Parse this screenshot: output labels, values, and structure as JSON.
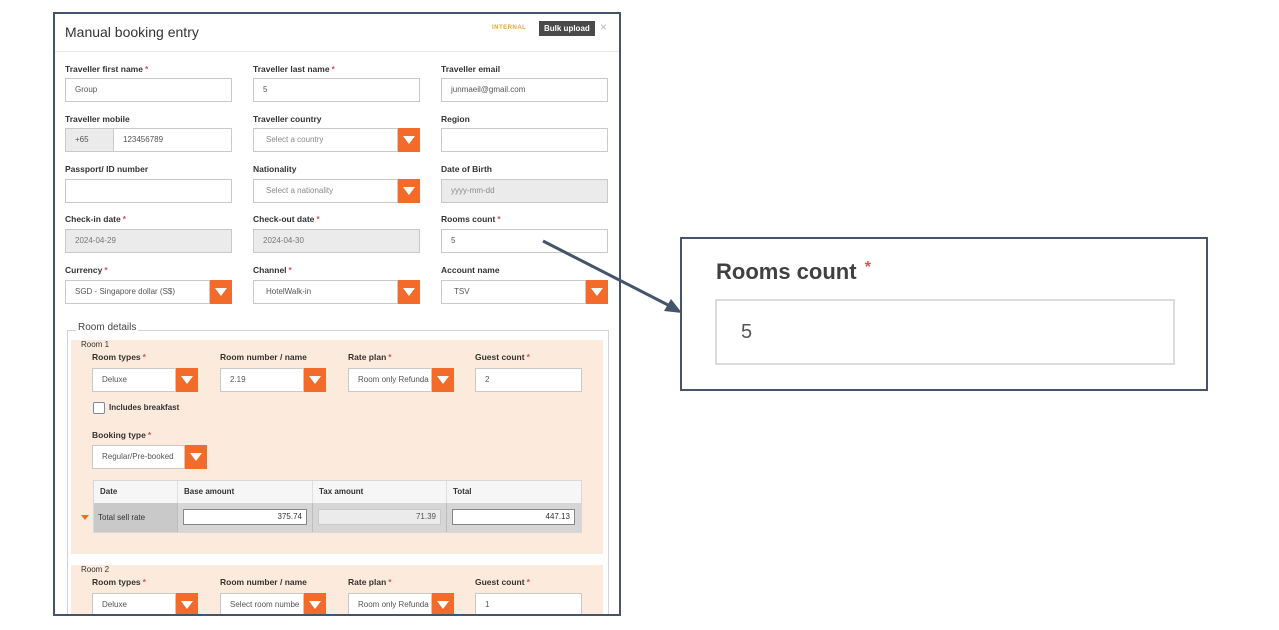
{
  "dialog": {
    "title": "Manual booking entry",
    "internal_tag": "INTERNAL",
    "bulk_upload_label": "Bulk upload",
    "close_glyph": "×"
  },
  "fields": {
    "first_name": {
      "label": "Traveller first name",
      "value": "Group",
      "required": true
    },
    "last_name": {
      "label": "Traveller last name",
      "value": "5",
      "required": true
    },
    "email": {
      "label": "Traveller email",
      "value": "junmaeil@gmail.com"
    },
    "mobile": {
      "label": "Traveller mobile",
      "prefix": "+65",
      "value": "123456789"
    },
    "country": {
      "label": "Traveller country",
      "placeholder": "Select a country"
    },
    "region": {
      "label": "Region",
      "value": ""
    },
    "passport": {
      "label": "Passport/ ID number",
      "value": ""
    },
    "nationality": {
      "label": "Nationality",
      "placeholder": "Select a nationality"
    },
    "dob": {
      "label": "Date of Birth",
      "placeholder": "yyyy-mm-dd"
    },
    "checkin": {
      "label": "Check-in date",
      "value": "2024-04-29",
      "required": true
    },
    "checkout": {
      "label": "Check-out date",
      "value": "2024-04-30",
      "required": true
    },
    "rooms_count": {
      "label": "Rooms count",
      "value": "5",
      "required": true
    },
    "currency": {
      "label": "Currency",
      "value": "SGD - Singapore dollar (S$)",
      "required": true
    },
    "channel": {
      "label": "Channel",
      "value": "HotelWalk-in",
      "required": true
    },
    "account": {
      "label": "Account name",
      "value": "TSV"
    }
  },
  "room_details": {
    "legend": "Room details",
    "room1": {
      "title": "Room 1",
      "room_types_label": "Room types",
      "room_type": "Deluxe",
      "room_number_label": "Room number / name",
      "room_number": "2.19",
      "rate_plan_label": "Rate plan",
      "rate_plan": "Room only Refunda",
      "guest_count_label": "Guest count",
      "guest_count": "2",
      "breakfast_label": "Includes breakfast",
      "breakfast_checked": false,
      "booking_type_label": "Booking type",
      "booking_type": "Regular/Pre-booked",
      "table": {
        "headers": [
          "Date",
          "Base amount",
          "Tax amount",
          "Total"
        ],
        "row_label": "Total sell rate",
        "base": "375.74",
        "tax": "71.39",
        "total": "447.13"
      }
    },
    "room2": {
      "title": "Room 2",
      "room_types_label": "Room types",
      "room_type": "Deluxe",
      "room_number_label": "Room number / name",
      "room_number_placeholder": "Select room numbe",
      "rate_plan_label": "Rate plan",
      "rate_plan": "Room only Refunda",
      "guest_count_label": "Guest count",
      "guest_count": "1"
    }
  },
  "callout": {
    "label": "Rooms count",
    "value": "5"
  },
  "required_mark": "*",
  "colors": {
    "accent": "#f26b2a",
    "frame": "#44546a",
    "room_bg": "#fcebdd",
    "required": "#d9534f"
  }
}
